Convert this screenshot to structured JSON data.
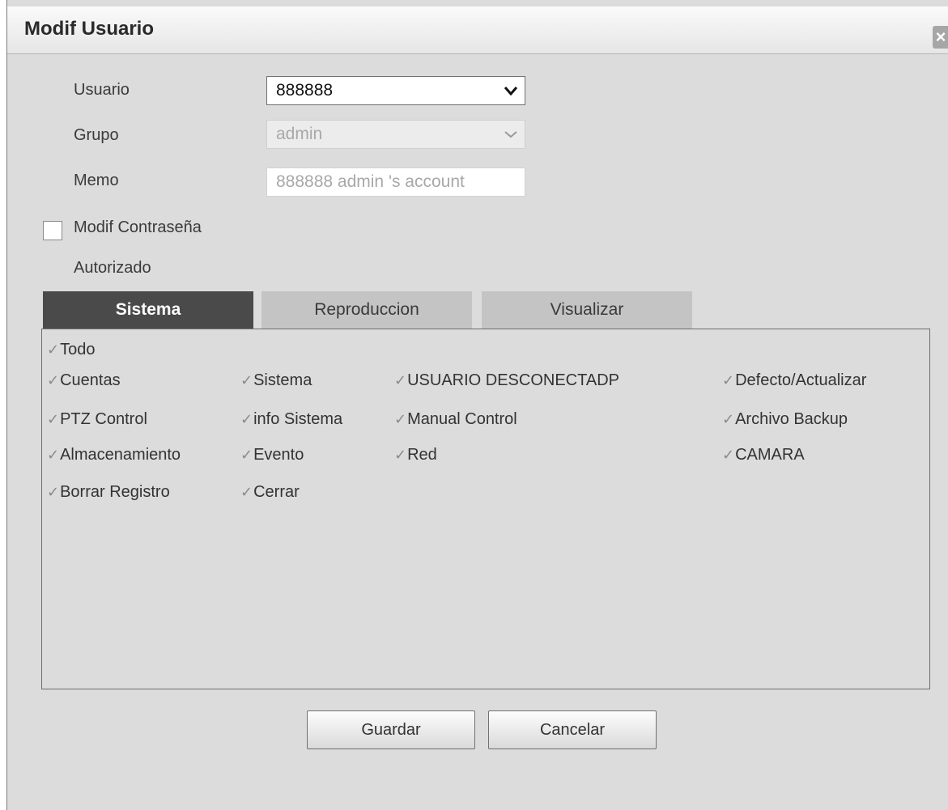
{
  "dialog": {
    "title": "Modif Usuario",
    "close_glyph": "×"
  },
  "form": {
    "user_label": "Usuario",
    "user_value": "888888",
    "group_label": "Grupo",
    "group_value": "admin",
    "memo_label": "Memo",
    "memo_value": "888888 admin 's account",
    "change_password_label": "Modif Contraseña",
    "change_password_checked": false,
    "authorized_label": "Autorizado"
  },
  "tabs": [
    {
      "label": "Sistema",
      "active": true
    },
    {
      "label": "Reproduccion",
      "active": false
    },
    {
      "label": "Visualizar",
      "active": false
    }
  ],
  "permissions": {
    "tick_glyph": "✓",
    "all": "Todo",
    "items": [
      "Cuentas",
      "Sistema",
      "USUARIO DESCONECTADP",
      "Defecto/Actualizar",
      "PTZ Control",
      "info Sistema",
      "Manual Control",
      "Archivo Backup",
      "Almacenamiento",
      "Evento",
      "Red",
      "CAMARA",
      "Borrar Registro",
      "Cerrar"
    ]
  },
  "buttons": {
    "save": "Guardar",
    "cancel": "Cancelar"
  },
  "colors": {
    "dialog_background": "#dcdcdc",
    "active_tab": "#4a4a4a",
    "inactive_tab": "#c4c4c4",
    "tick": "#8a8a8a"
  },
  "icons": {
    "dropdown": "chevron-down-icon",
    "close": "close-icon",
    "check": "check-icon"
  }
}
